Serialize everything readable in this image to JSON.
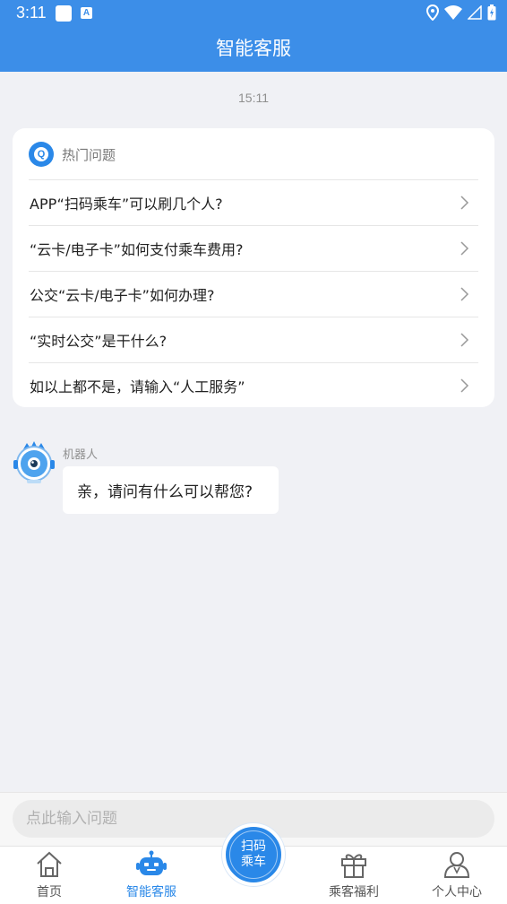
{
  "status": {
    "time": "3:11"
  },
  "header": {
    "title": "智能客服"
  },
  "chat": {
    "timestamp": "15:11"
  },
  "hot": {
    "label": "热门问题",
    "questions": [
      "APP“扫码乘车”可以刷几个人?",
      "“云卡/电子卡”如何支付乘车费用?",
      "公交“云卡/电子卡”如何办理?",
      "“实时公交”是干什么?",
      "如以上都不是，请输入“人工服务”"
    ]
  },
  "bot": {
    "name": "机器人",
    "message": "亲，请问有什么可以帮您?"
  },
  "input": {
    "placeholder": "点此输入问题"
  },
  "tabs": {
    "home": "首页",
    "service": "智能客服",
    "benefits": "乘客福利",
    "profile": "个人中心"
  },
  "scan": {
    "line1": "扫码",
    "line2": "乘车"
  },
  "colors": {
    "primary": "#3c8ee8",
    "accent": "#2a88e8",
    "background": "#f0f1f5"
  },
  "icons": {
    "status": [
      "notification-square-icon",
      "a-badge-icon",
      "location-icon",
      "wifi-icon",
      "signal-icon",
      "battery-icon"
    ],
    "tabs": [
      "home-icon",
      "robot-icon",
      "gift-icon",
      "person-icon"
    ]
  }
}
